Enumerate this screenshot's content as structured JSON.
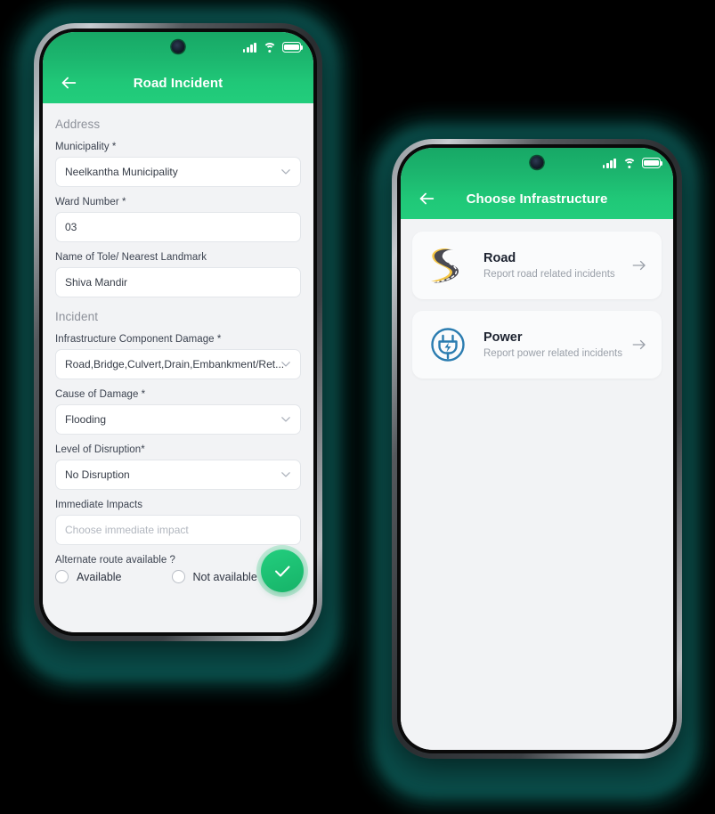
{
  "theme": {
    "accent_green": "#1cb56e",
    "accent_green_bright": "#22cd7c",
    "glow_teal": "#0d5a55",
    "page_bg": "#f2f3f5",
    "power_blue": "#2a7cb0",
    "road_yellow": "#f5c644",
    "road_asphalt": "#4a4a52"
  },
  "left_phone": {
    "status_bar": {
      "signal_icon": "signal-bars-icon",
      "wifi_icon": "wifi-icon",
      "battery_icon": "battery-full-icon",
      "camera_icon": "front-camera-icon"
    },
    "header": {
      "back_icon": "back-arrow-icon",
      "title": "Road Incident"
    },
    "sections": [
      {
        "title": "Address"
      },
      {
        "title": "Incident"
      }
    ],
    "fields": {
      "municipality": {
        "label": "Municipality *",
        "value": "Neelkantha Municipality",
        "type": "dropdown",
        "chevron_icon": "chevron-down-icon"
      },
      "ward_number": {
        "label": "Ward Number *",
        "value": "03",
        "type": "text"
      },
      "tole_landmark": {
        "label": "Name of Tole/ Nearest Landmark",
        "value": "Shiva Mandir",
        "type": "text"
      },
      "infrastructure_component": {
        "label": "Infrastructure Component Damage *",
        "value": "Road,Bridge,Culvert,Drain,Embankment/Ret...",
        "type": "dropdown",
        "chevron_icon": "chevron-down-icon"
      },
      "cause_of_damage": {
        "label": "Cause of Damage *",
        "value": "Flooding",
        "type": "dropdown",
        "chevron_icon": "chevron-down-icon"
      },
      "level_of_disruption": {
        "label": "Level of Disruption*",
        "value": "No Disruption",
        "type": "dropdown",
        "chevron_icon": "chevron-down-icon"
      },
      "immediate_impacts": {
        "label": "Immediate Impacts",
        "value": "",
        "placeholder": "Choose immediate impact",
        "type": "text"
      },
      "alternate_route": {
        "label": "Alternate route available ?",
        "options": [
          {
            "label": "Available",
            "selected": false
          },
          {
            "label": "Not available",
            "selected": false
          }
        ]
      }
    },
    "fab": {
      "icon": "check-icon",
      "color": "#1cb56e"
    }
  },
  "right_phone": {
    "status_bar": {
      "signal_icon": "signal-bars-icon",
      "wifi_icon": "wifi-icon",
      "battery_icon": "battery-full-icon",
      "camera_icon": "front-camera-icon"
    },
    "header": {
      "back_icon": "back-arrow-icon",
      "title": "Choose Infrastructure"
    },
    "cards": [
      {
        "icon": "road-icon",
        "name": "Road",
        "description": "Report road related incidents",
        "arrow_icon": "arrow-right-icon"
      },
      {
        "icon": "power-plug-icon",
        "name": "Power",
        "description": "Report power related incidents",
        "arrow_icon": "arrow-right-icon"
      }
    ]
  }
}
